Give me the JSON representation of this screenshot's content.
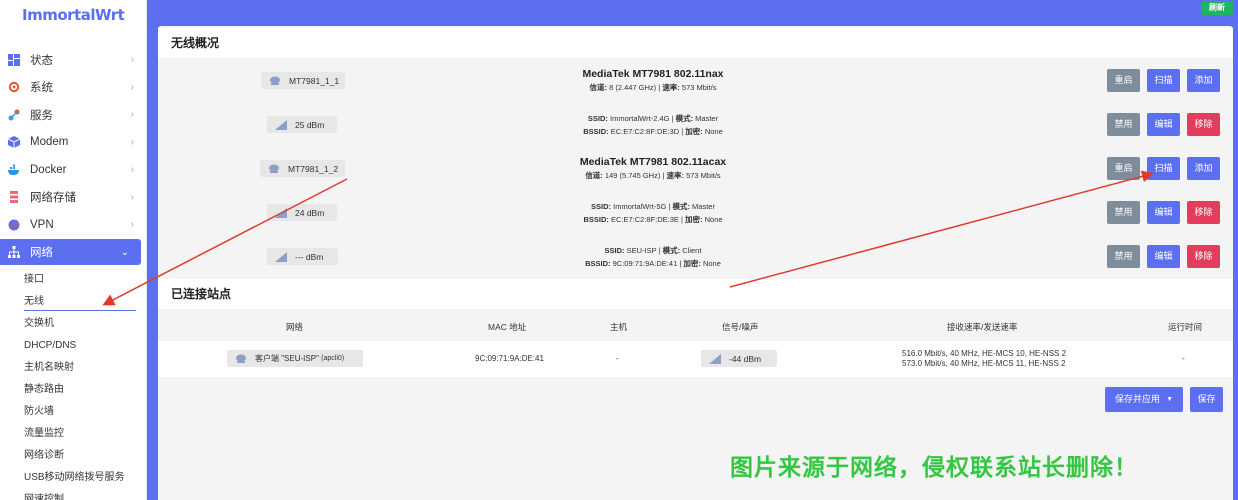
{
  "app": {
    "logo": "ImmortalWrt",
    "refresh_label": "刷新"
  },
  "sidebar": {
    "items": [
      {
        "label": "状态",
        "icon": "dashboard-icon"
      },
      {
        "label": "系统",
        "icon": "gear-icon"
      },
      {
        "label": "服务",
        "icon": "services-icon"
      },
      {
        "label": "Modem",
        "icon": "cube-icon"
      },
      {
        "label": "Docker",
        "icon": "docker-icon"
      },
      {
        "label": "网络存储",
        "icon": "storage-icon"
      },
      {
        "label": "VPN",
        "icon": "globe-icon"
      },
      {
        "label": "网络",
        "icon": "network-icon"
      }
    ],
    "sub_items": [
      {
        "label": "接口"
      },
      {
        "label": "无线"
      },
      {
        "label": "交换机"
      },
      {
        "label": "DHCP/DNS"
      },
      {
        "label": "主机名映射"
      },
      {
        "label": "静态路由"
      },
      {
        "label": "防火墙"
      },
      {
        "label": "流量监控"
      },
      {
        "label": "网络诊断"
      },
      {
        "label": "USB移动网络拨号服务"
      },
      {
        "label": "网速控制"
      }
    ]
  },
  "wireless": {
    "title": "无线概况",
    "radios": [
      {
        "pill": "MT7981_1_1",
        "name": "MediaTek MT7981 802.11nax",
        "channel_label": "信道:",
        "channel": "8 (2.447 GHz)",
        "rate_label": "速率:",
        "rate": "573 Mbit/s",
        "buttons": [
          "重启",
          "扫描",
          "添加"
        ]
      },
      {
        "pill": "MT7981_1_2",
        "name": "MediaTek MT7981 802.11acax",
        "channel_label": "信道:",
        "channel": "149 (5.745 GHz)",
        "rate_label": "速率:",
        "rate": "573 Mbit/s",
        "buttons": [
          "重启",
          "扫描",
          "添加"
        ]
      }
    ],
    "interfaces": [
      {
        "signal": "25 dBm",
        "ssid_label": "SSID:",
        "ssid": "ImmortalWrt-2.4G",
        "mode_label": "模式:",
        "mode": "Master",
        "bssid_label": "BSSID:",
        "bssid": "EC:E7:C2:8F:DE:3D",
        "enc_label": "加密:",
        "enc": "None",
        "buttons": [
          "禁用",
          "编辑",
          "移除"
        ]
      },
      {
        "signal": "24 dBm",
        "ssid_label": "SSID:",
        "ssid": "ImmortalWrt-5G",
        "mode_label": "模式:",
        "mode": "Master",
        "bssid_label": "BSSID:",
        "bssid": "EC:E7:C2:8F:DE:3E",
        "enc_label": "加密:",
        "enc": "None",
        "buttons": [
          "禁用",
          "编辑",
          "移除"
        ]
      },
      {
        "signal": "--- dBm",
        "ssid_label": "SSID:",
        "ssid": "SEU-ISP",
        "mode_label": "模式:",
        "mode": "Client",
        "bssid_label": "BSSID:",
        "bssid": "9C:09:71:9A:DE:41",
        "enc_label": "加密:",
        "enc": "None",
        "buttons": [
          "禁用",
          "编辑",
          "移除"
        ]
      }
    ]
  },
  "stations": {
    "title": "已连接站点",
    "columns": [
      "网络",
      "MAC 地址",
      "主机",
      "信号/噪声",
      "接收速率/发送速率",
      "运行时间"
    ],
    "rows": [
      {
        "network": "客户端 \"SEU-ISP\"",
        "network_iface": "(apcli0)",
        "mac": "9C:09:71:9A:DE:41",
        "host": "-",
        "signal": "-44 dBm",
        "rx": "516.0 Mbit/s, 40 MHz, HE-MCS 10, HE-NSS 2",
        "tx": "573.0 Mbit/s, 40 MHz, HE-MCS 11, HE-NSS 2",
        "uptime": "-"
      }
    ]
  },
  "actions": {
    "save_apply": "保存并应用",
    "save": "保存"
  },
  "watermark": "图片来源于网络，侵权联系站长删除！",
  "colors": {
    "accent": "#5b6ff0",
    "danger": "#e33d5e",
    "neutral": "#7f8c9a",
    "success": "#1fb365",
    "arrow": "#e03a2f"
  }
}
